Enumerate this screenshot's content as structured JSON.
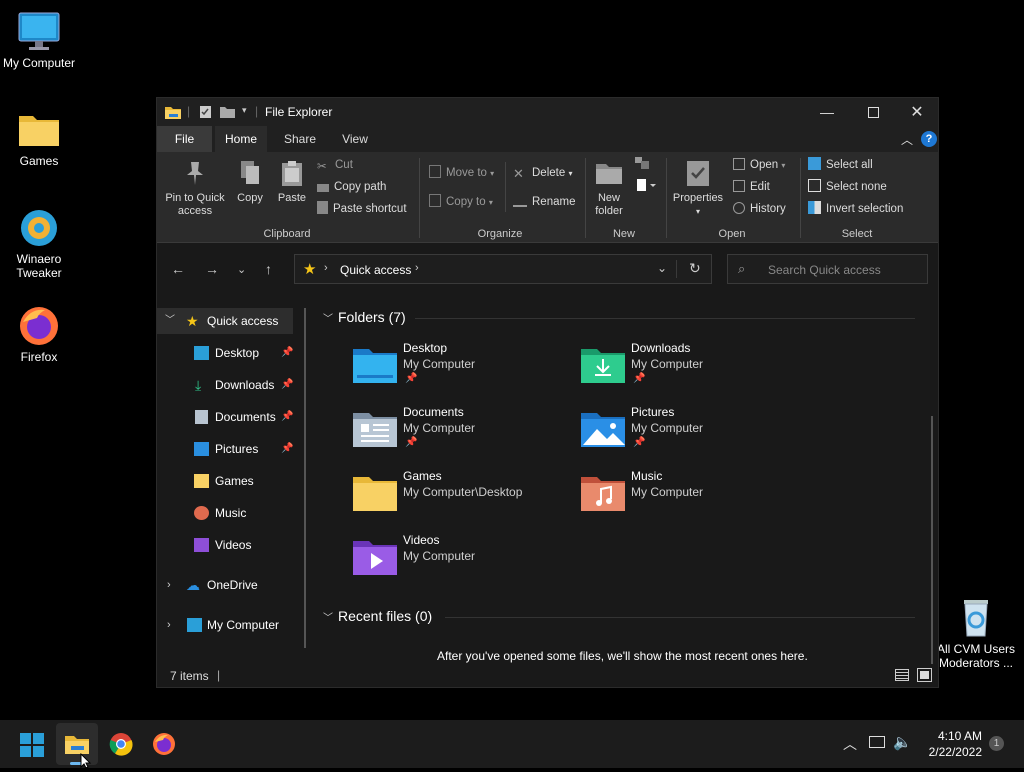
{
  "desktop": {
    "icons": [
      {
        "label": "My Computer"
      },
      {
        "label": "Games"
      },
      {
        "label": "Winaero Tweaker"
      },
      {
        "label": "Firefox"
      },
      {
        "label": "All CVM Users Moderators ..."
      }
    ]
  },
  "window": {
    "title": "File Explorer",
    "tabs": [
      "File",
      "Home",
      "Share",
      "View"
    ],
    "ribbon": {
      "clipboard": {
        "label": "Clipboard",
        "pin": "Pin to Quick access",
        "copy": "Copy",
        "paste": "Paste",
        "cut": "Cut",
        "copy_path": "Copy path",
        "paste_shortcut": "Paste shortcut"
      },
      "organize": {
        "label": "Organize",
        "move_to": "Move to",
        "copy_to": "Copy to",
        "delete": "Delete",
        "rename": "Rename"
      },
      "new": {
        "label": "New",
        "new_folder": "New folder"
      },
      "open": {
        "label": "Open",
        "properties": "Properties",
        "open": "Open",
        "edit": "Edit",
        "history": "History"
      },
      "select": {
        "label": "Select",
        "select_all": "Select all",
        "select_none": "Select none",
        "invert": "Invert selection"
      }
    },
    "address": {
      "path": "Quick access",
      "search_placeholder": "Search Quick access"
    },
    "sidebar": {
      "quick_access": "Quick access",
      "items": [
        {
          "label": "Desktop",
          "pinned": true
        },
        {
          "label": "Downloads",
          "pinned": true
        },
        {
          "label": "Documents",
          "pinned": true
        },
        {
          "label": "Pictures",
          "pinned": true
        },
        {
          "label": "Games",
          "pinned": false
        },
        {
          "label": "Music",
          "pinned": false
        },
        {
          "label": "Videos",
          "pinned": false
        }
      ],
      "onedrive": "OneDrive",
      "my_computer": "My Computer"
    },
    "content": {
      "folders_header": "Folders (7)",
      "folders": [
        {
          "name": "Desktop",
          "location": "My Computer"
        },
        {
          "name": "Downloads",
          "location": "My Computer"
        },
        {
          "name": "Documents",
          "location": "My Computer"
        },
        {
          "name": "Pictures",
          "location": "My Computer"
        },
        {
          "name": "Games",
          "location": "My Computer\\Desktop"
        },
        {
          "name": "Music",
          "location": "My Computer"
        },
        {
          "name": "Videos",
          "location": "My Computer"
        }
      ],
      "recent_header": "Recent files (0)",
      "recent_empty": "After you've opened some files, we'll show the most recent ones here."
    },
    "status": {
      "items": "7 items"
    }
  },
  "taskbar": {
    "time": "4:10 AM",
    "date": "2/22/2022",
    "notification_count": "1"
  },
  "colors": {
    "accent": "#0078d4",
    "folder_yellow": "#f8d164",
    "window_bg": "#191919",
    "ribbon_bg": "#2b2b2b"
  }
}
